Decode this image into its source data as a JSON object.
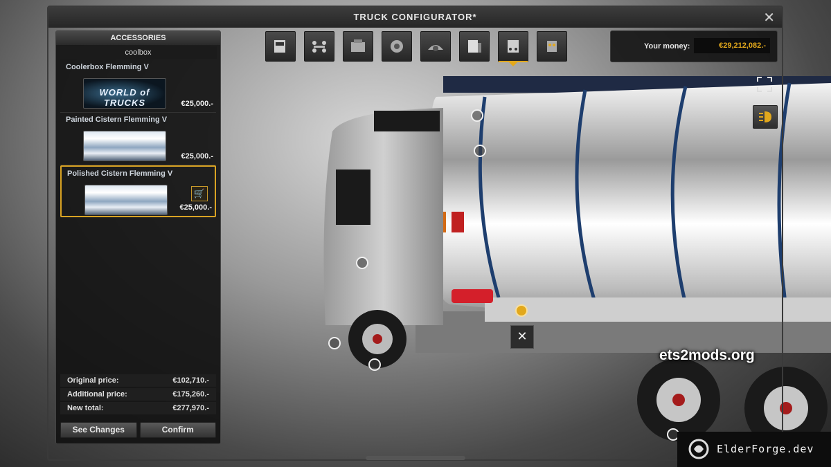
{
  "window": {
    "title": "TRUCK CONFIGURATOR*",
    "close_symbol": "✕"
  },
  "accessories_panel": {
    "header": "ACCESSORIES",
    "category": "coolbox",
    "items": [
      {
        "title": "Coolerbox Flemming V",
        "price": "€25,000.-",
        "thumb_text": "WORLD of TRUCKS"
      },
      {
        "title": "Painted Cistern Flemming V",
        "price": "€25,000.-"
      },
      {
        "title": "Polished Cistern Flemming V",
        "price": "€25,000.-",
        "selected": true
      }
    ],
    "prices": [
      {
        "label": "Original price:",
        "value": "€102,710.-"
      },
      {
        "label": "Additional price:",
        "value": "€175,260.-"
      },
      {
        "label": "New total:",
        "value": "€277,970.-"
      }
    ],
    "buttons": {
      "see_changes": "See Changes",
      "confirm": "Confirm"
    }
  },
  "toolbar": {
    "tools": [
      "cabin-icon",
      "chassis-icon",
      "engine-icon",
      "transmission-icon",
      "interior-icon",
      "paint-icon",
      "accessories-icon",
      "lights-icon"
    ],
    "active_index": 6
  },
  "money": {
    "label": "Your money:",
    "value": "€29,212,082.-"
  },
  "side_buttons": [
    "fullscreen-icon",
    "headlight-icon"
  ],
  "delete_symbol": "✕",
  "watermarks": {
    "site": "ets2mods.org",
    "brand": "ElderForge.dev"
  },
  "colors": {
    "accent": "#e2a81c",
    "panel": "#121212"
  }
}
